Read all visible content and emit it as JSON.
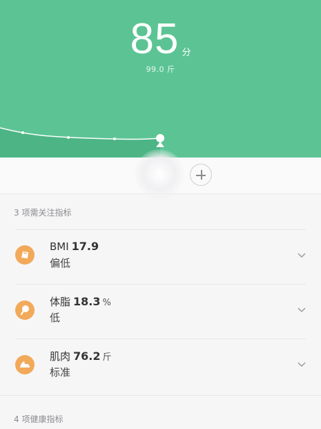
{
  "header": {
    "score": "85",
    "score_unit": "分",
    "weight": "99.0 斤",
    "accent_color": "#5cc494"
  },
  "attention_section": {
    "title": "3 项需关注指标"
  },
  "metrics": [
    {
      "label": "BMI",
      "value": "17.9",
      "unit": "",
      "status": "偏低",
      "icon": "bmi-icon",
      "icon_color": "#f2a95a"
    },
    {
      "label": "体脂",
      "value": "18.3",
      "unit": "%",
      "status": "低",
      "icon": "body-fat-icon",
      "icon_color": "#f2a95a"
    },
    {
      "label": "肌肉",
      "value": "76.2",
      "unit": "斤",
      "status": "标准",
      "icon": "muscle-icon",
      "icon_color": "#f2a95a"
    }
  ],
  "health_section": {
    "title": "4 项健康指标"
  }
}
